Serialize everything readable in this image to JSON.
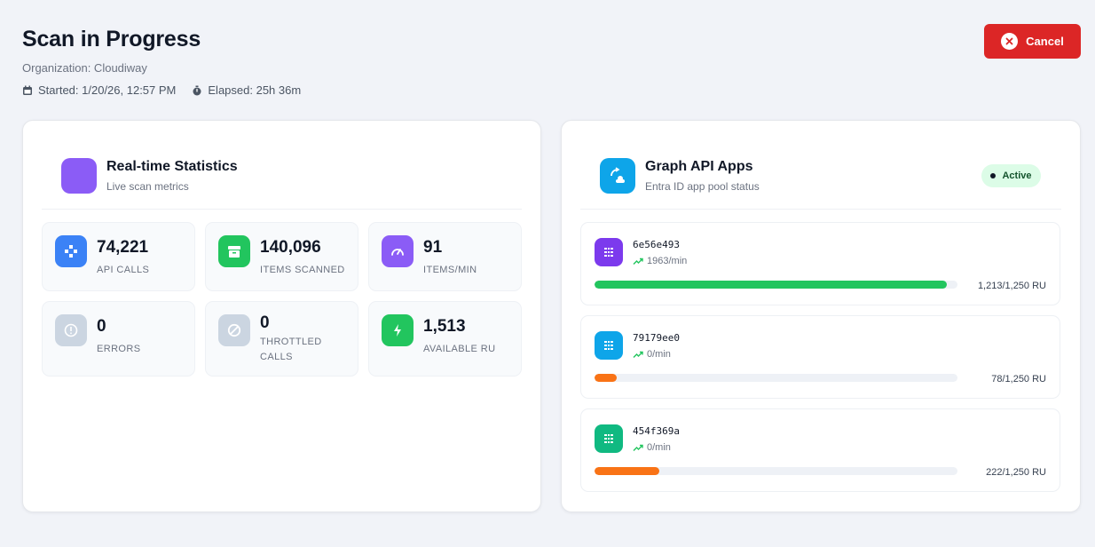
{
  "header": {
    "title": "Scan in Progress",
    "organization": "Organization: Cloudiway",
    "started": "Started: 1/20/26, 12:57 PM",
    "elapsed": "Elapsed: 25h 36m"
  },
  "cancel_label": "Cancel",
  "stats": {
    "title": "Real-time Statistics",
    "subtitle": "Live scan metrics",
    "tiles": [
      {
        "value": "74,221",
        "label": "API CALLS",
        "icon": "network-icon",
        "color": "#3b82f6"
      },
      {
        "value": "140,096",
        "label": "ITEMS SCANNED",
        "icon": "archive-icon",
        "color": "#22c55e"
      },
      {
        "value": "91",
        "label": "ITEMS/MIN",
        "icon": "gauge-icon",
        "color": "#8b5cf6"
      },
      {
        "value": "0",
        "label": "ERRORS",
        "icon": "alert-icon",
        "color": "#cbd5e1"
      },
      {
        "value": "0",
        "label": "THROTTLED CALLS",
        "icon": "ban-icon",
        "color": "#cbd5e1"
      },
      {
        "value": "1,513",
        "label": "AVAILABLE RU",
        "icon": "bolt-icon",
        "color": "#22c55e"
      }
    ]
  },
  "apps": {
    "title": "Graph API Apps",
    "subtitle": "Entra ID app pool status",
    "badge": "Active",
    "items": [
      {
        "id": "6e56e493",
        "rate": "1963/min",
        "ru_text": "1,213/1,250 RU",
        "fraction": 0.97,
        "icon_color": "#7c3aed",
        "bar_color": "#22c55e"
      },
      {
        "id": "79179ee0",
        "rate": "0/min",
        "ru_text": "78/1,250 RU",
        "fraction": 0.062,
        "icon_color": "#0ea5e9",
        "bar_color": "#f97316"
      },
      {
        "id": "454f369a",
        "rate": "0/min",
        "ru_text": "222/1,250 RU",
        "fraction": 0.178,
        "icon_color": "#10b981",
        "bar_color": "#f97316"
      }
    ]
  },
  "colors": {
    "danger": "#dc2626",
    "success": "#22c55e",
    "warning": "#f97316"
  }
}
